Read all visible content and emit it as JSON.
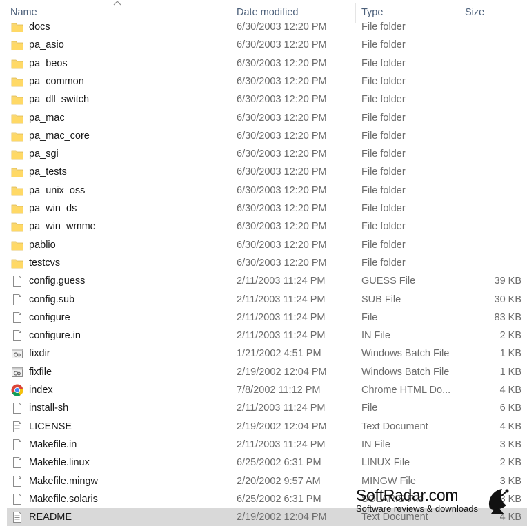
{
  "columns": {
    "name": "Name",
    "date": "Date modified",
    "type": "Type",
    "size": "Size"
  },
  "files": [
    {
      "name": "docs",
      "date": "6/30/2003 12:20 PM",
      "type": "File folder",
      "size": "",
      "icon": "folder-icon"
    },
    {
      "name": "pa_asio",
      "date": "6/30/2003 12:20 PM",
      "type": "File folder",
      "size": "",
      "icon": "folder-icon"
    },
    {
      "name": "pa_beos",
      "date": "6/30/2003 12:20 PM",
      "type": "File folder",
      "size": "",
      "icon": "folder-icon"
    },
    {
      "name": "pa_common",
      "date": "6/30/2003 12:20 PM",
      "type": "File folder",
      "size": "",
      "icon": "folder-icon"
    },
    {
      "name": "pa_dll_switch",
      "date": "6/30/2003 12:20 PM",
      "type": "File folder",
      "size": "",
      "icon": "folder-icon"
    },
    {
      "name": "pa_mac",
      "date": "6/30/2003 12:20 PM",
      "type": "File folder",
      "size": "",
      "icon": "folder-icon"
    },
    {
      "name": "pa_mac_core",
      "date": "6/30/2003 12:20 PM",
      "type": "File folder",
      "size": "",
      "icon": "folder-icon"
    },
    {
      "name": "pa_sgi",
      "date": "6/30/2003 12:20 PM",
      "type": "File folder",
      "size": "",
      "icon": "folder-icon"
    },
    {
      "name": "pa_tests",
      "date": "6/30/2003 12:20 PM",
      "type": "File folder",
      "size": "",
      "icon": "folder-icon"
    },
    {
      "name": "pa_unix_oss",
      "date": "6/30/2003 12:20 PM",
      "type": "File folder",
      "size": "",
      "icon": "folder-icon"
    },
    {
      "name": "pa_win_ds",
      "date": "6/30/2003 12:20 PM",
      "type": "File folder",
      "size": "",
      "icon": "folder-icon"
    },
    {
      "name": "pa_win_wmme",
      "date": "6/30/2003 12:20 PM",
      "type": "File folder",
      "size": "",
      "icon": "folder-icon"
    },
    {
      "name": "pablio",
      "date": "6/30/2003 12:20 PM",
      "type": "File folder",
      "size": "",
      "icon": "folder-icon"
    },
    {
      "name": "testcvs",
      "date": "6/30/2003 12:20 PM",
      "type": "File folder",
      "size": "",
      "icon": "folder-icon"
    },
    {
      "name": "config.guess",
      "date": "2/11/2003 11:24 PM",
      "type": "GUESS File",
      "size": "39 KB",
      "icon": "file-icon"
    },
    {
      "name": "config.sub",
      "date": "2/11/2003 11:24 PM",
      "type": "SUB File",
      "size": "30 KB",
      "icon": "file-icon"
    },
    {
      "name": "configure",
      "date": "2/11/2003 11:24 PM",
      "type": "File",
      "size": "83 KB",
      "icon": "file-icon"
    },
    {
      "name": "configure.in",
      "date": "2/11/2003 11:24 PM",
      "type": "IN File",
      "size": "2 KB",
      "icon": "file-icon"
    },
    {
      "name": "fixdir",
      "date": "1/21/2002 4:51 PM",
      "type": "Windows Batch File",
      "size": "1 KB",
      "icon": "batch-file-icon"
    },
    {
      "name": "fixfile",
      "date": "2/19/2002 12:04 PM",
      "type": "Windows Batch File",
      "size": "1 KB",
      "icon": "batch-file-icon"
    },
    {
      "name": "index",
      "date": "7/8/2002 11:12 PM",
      "type": "Chrome HTML Do...",
      "size": "4 KB",
      "icon": "chrome-icon"
    },
    {
      "name": "install-sh",
      "date": "2/11/2003 11:24 PM",
      "type": "File",
      "size": "6 KB",
      "icon": "file-icon"
    },
    {
      "name": "LICENSE",
      "date": "2/19/2002 12:04 PM",
      "type": "Text Document",
      "size": "4 KB",
      "icon": "text-document-icon"
    },
    {
      "name": "Makefile.in",
      "date": "2/11/2003 11:24 PM",
      "type": "IN File",
      "size": "3 KB",
      "icon": "file-icon"
    },
    {
      "name": "Makefile.linux",
      "date": "6/25/2002 6:31 PM",
      "type": "LINUX File",
      "size": "2 KB",
      "icon": "file-icon"
    },
    {
      "name": "Makefile.mingw",
      "date": "2/20/2002 9:57 AM",
      "type": "MINGW File",
      "size": "3 KB",
      "icon": "file-icon"
    },
    {
      "name": "Makefile.solaris",
      "date": "6/25/2002 6:31 PM",
      "type": "SOLARIS File",
      "size": "3 KB",
      "icon": "file-icon"
    },
    {
      "name": "README",
      "date": "2/19/2002 12:04 PM",
      "type": "Text Document",
      "size": "4 KB",
      "icon": "text-document-icon",
      "selected": true
    }
  ],
  "watermark": {
    "title": "SoftRadar.com",
    "subtitle": "Software reviews & downloads"
  },
  "colors": {
    "header_text": "#4c607a",
    "folder": "#f8d775",
    "selected_row": "#d9d9d9"
  }
}
